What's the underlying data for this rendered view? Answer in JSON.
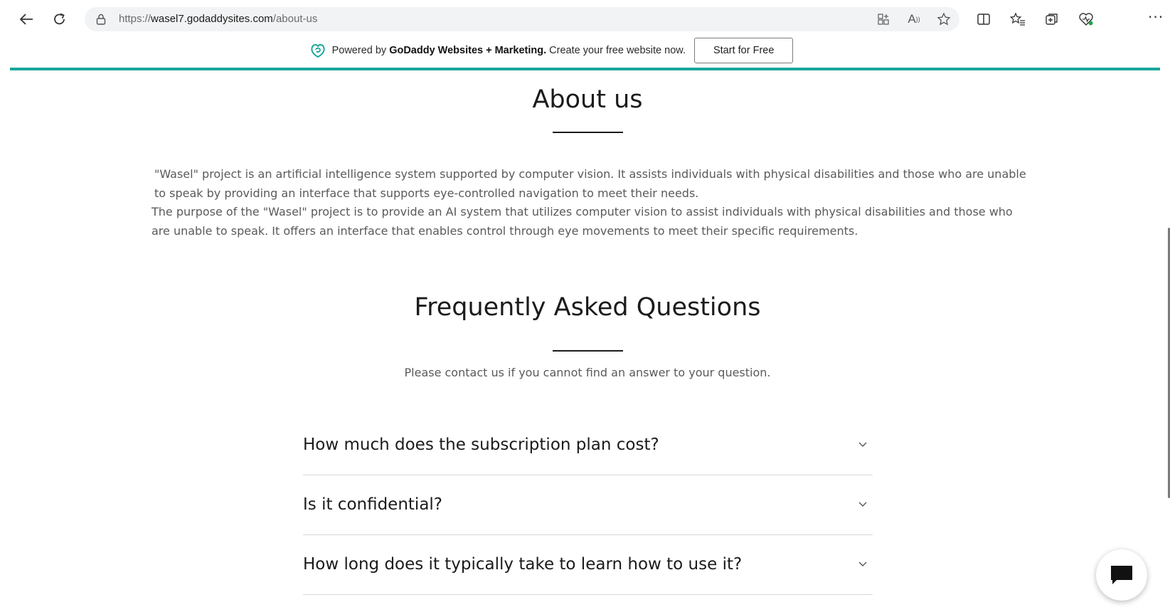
{
  "browser": {
    "url_scheme": "https://",
    "url_host": "wasel7.godaddysites.com",
    "url_path": "/about-us",
    "icons": [
      "back-arrow-icon",
      "refresh-icon",
      "lock-icon",
      "app-available-icon",
      "read-aloud-icon",
      "favorite-star-icon",
      "split-screen-icon",
      "favorites-icon",
      "collections-icon",
      "browser-essentials-icon",
      "more-icon"
    ],
    "read_aloud_label": "A",
    "more_label": "···"
  },
  "banner": {
    "prefix": "Powered by ",
    "brand": "GoDaddy Websites + Marketing.",
    "suffix": " Create your free website now.",
    "button_label": "Start for Free",
    "accent_color": "#1aa79b"
  },
  "about": {
    "title": "About us",
    "paragraphs": [
      "\"Wasel\" project is an artificial intelligence system supported by computer vision. It assists individuals with physical disabilities and those who are unable to speak by providing an interface that supports eye-controlled navigation to meet their needs.",
      "The purpose of the \"Wasel\" project is to provide an AI system that utilizes computer vision to assist individuals with physical disabilities and those who are unable to speak. It offers an interface that enables control through eye movements to meet their specific requirements."
    ]
  },
  "faq": {
    "title": "Frequently Asked Questions",
    "subtitle": "Please contact us if you cannot find an answer to your question.",
    "items": [
      {
        "question": "How much does the subscription plan cost?"
      },
      {
        "question": "Is it confidential?"
      },
      {
        "question": "How long does it typically take to learn how to use it?"
      }
    ]
  },
  "chat": {
    "icon": "chat-bubble-icon"
  }
}
